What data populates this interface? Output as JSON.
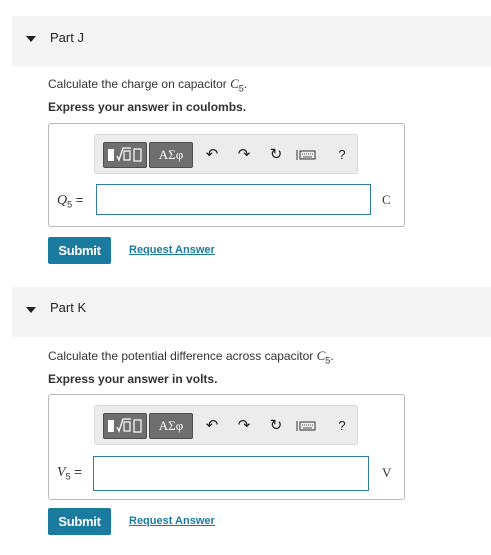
{
  "parts": [
    {
      "title": "Part J",
      "prompt_text": "Calculate the charge on capacitor ",
      "prompt_var": "C",
      "prompt_sub": "5",
      "instruction": "Express your answer in coulombs.",
      "var_symbol": "Q",
      "var_sub": "5",
      "equals": "=",
      "unit": "C",
      "input_value": "",
      "submit_label": "Submit",
      "request_label": "Request Answer"
    },
    {
      "title": "Part K",
      "prompt_text": "Calculate the potential difference across capacitor ",
      "prompt_var": "C",
      "prompt_sub": "5",
      "instruction": "Express your answer in volts.",
      "var_symbol": "V",
      "var_sub": "5",
      "equals": "=",
      "unit": "V",
      "input_value": "",
      "submit_label": "Submit",
      "request_label": "Request Answer"
    }
  ],
  "toolbar": {
    "symbols_label": "ΑΣφ",
    "help_label": "?",
    "icons": [
      "templates-icon",
      "symbols-icon",
      "undo-icon",
      "redo-icon",
      "reset-icon",
      "keyboard-icon",
      "help-icon"
    ]
  },
  "colors": {
    "accent": "#1a7b9f",
    "header_bg": "#f4f4f4",
    "toolbar_btn": "#6f6f6f"
  }
}
